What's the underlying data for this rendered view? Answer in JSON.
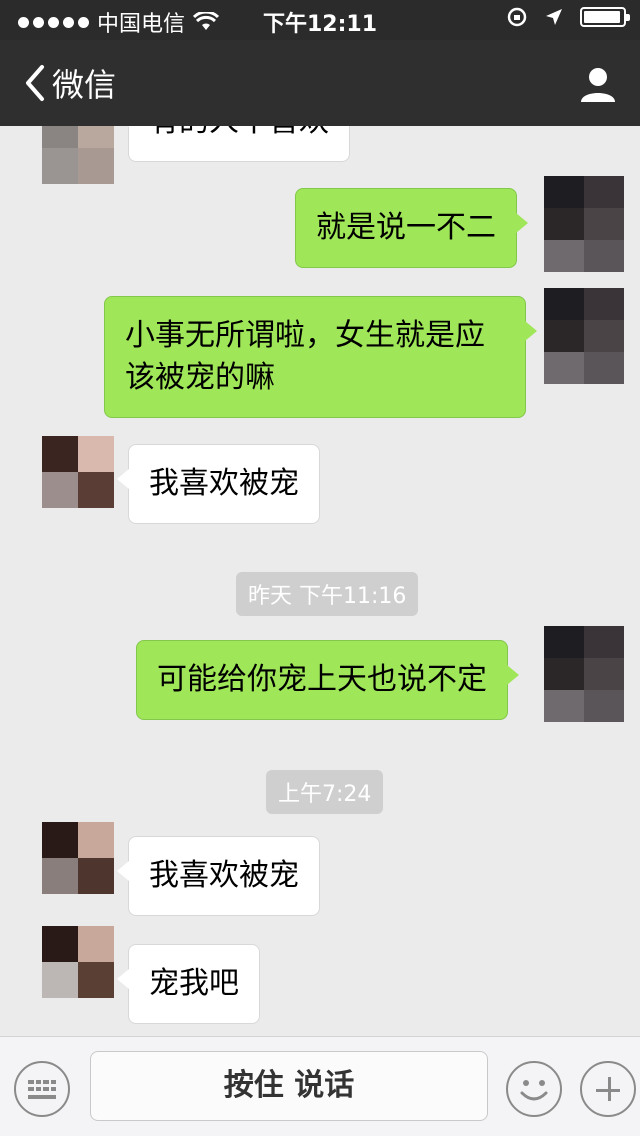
{
  "status_bar": {
    "carrier": "中国电信",
    "time": "下午12:11",
    "signal_icon": "signal-dots-icon",
    "wifi_icon": "wifi-icon",
    "battery_icon": "battery-icon"
  },
  "nav": {
    "back_label": "微信",
    "back_icon": "chevron-left-icon",
    "profile_icon": "person-icon"
  },
  "messages": [
    {
      "side": "in",
      "text": "有的人不喜欢"
    },
    {
      "side": "out",
      "text": "就是说一不二"
    },
    {
      "side": "out",
      "text": "小事无所谓啦，女生就是应该被宠的嘛"
    },
    {
      "side": "in",
      "text": "我喜欢被宠"
    },
    {
      "side": "out",
      "text": "可能给你宠上天也说不定"
    },
    {
      "side": "in",
      "text": "我喜欢被宠"
    },
    {
      "side": "in",
      "text": "宠我吧"
    }
  ],
  "timestamps": [
    "昨天 下午11:16",
    "上午7:24"
  ],
  "input_bar": {
    "hold_to_talk": "按住 说话",
    "keyboard_icon": "keyboard-icon",
    "emoji_icon": "emoji-icon",
    "plus_icon": "plus-icon"
  },
  "colors": {
    "header_bg": "#2f2f2f",
    "chat_bg": "#ebebeb",
    "outgoing_bubble": "#9fe658",
    "incoming_bubble": "#ffffff",
    "timestamp_bg": "#cfcfcf"
  }
}
